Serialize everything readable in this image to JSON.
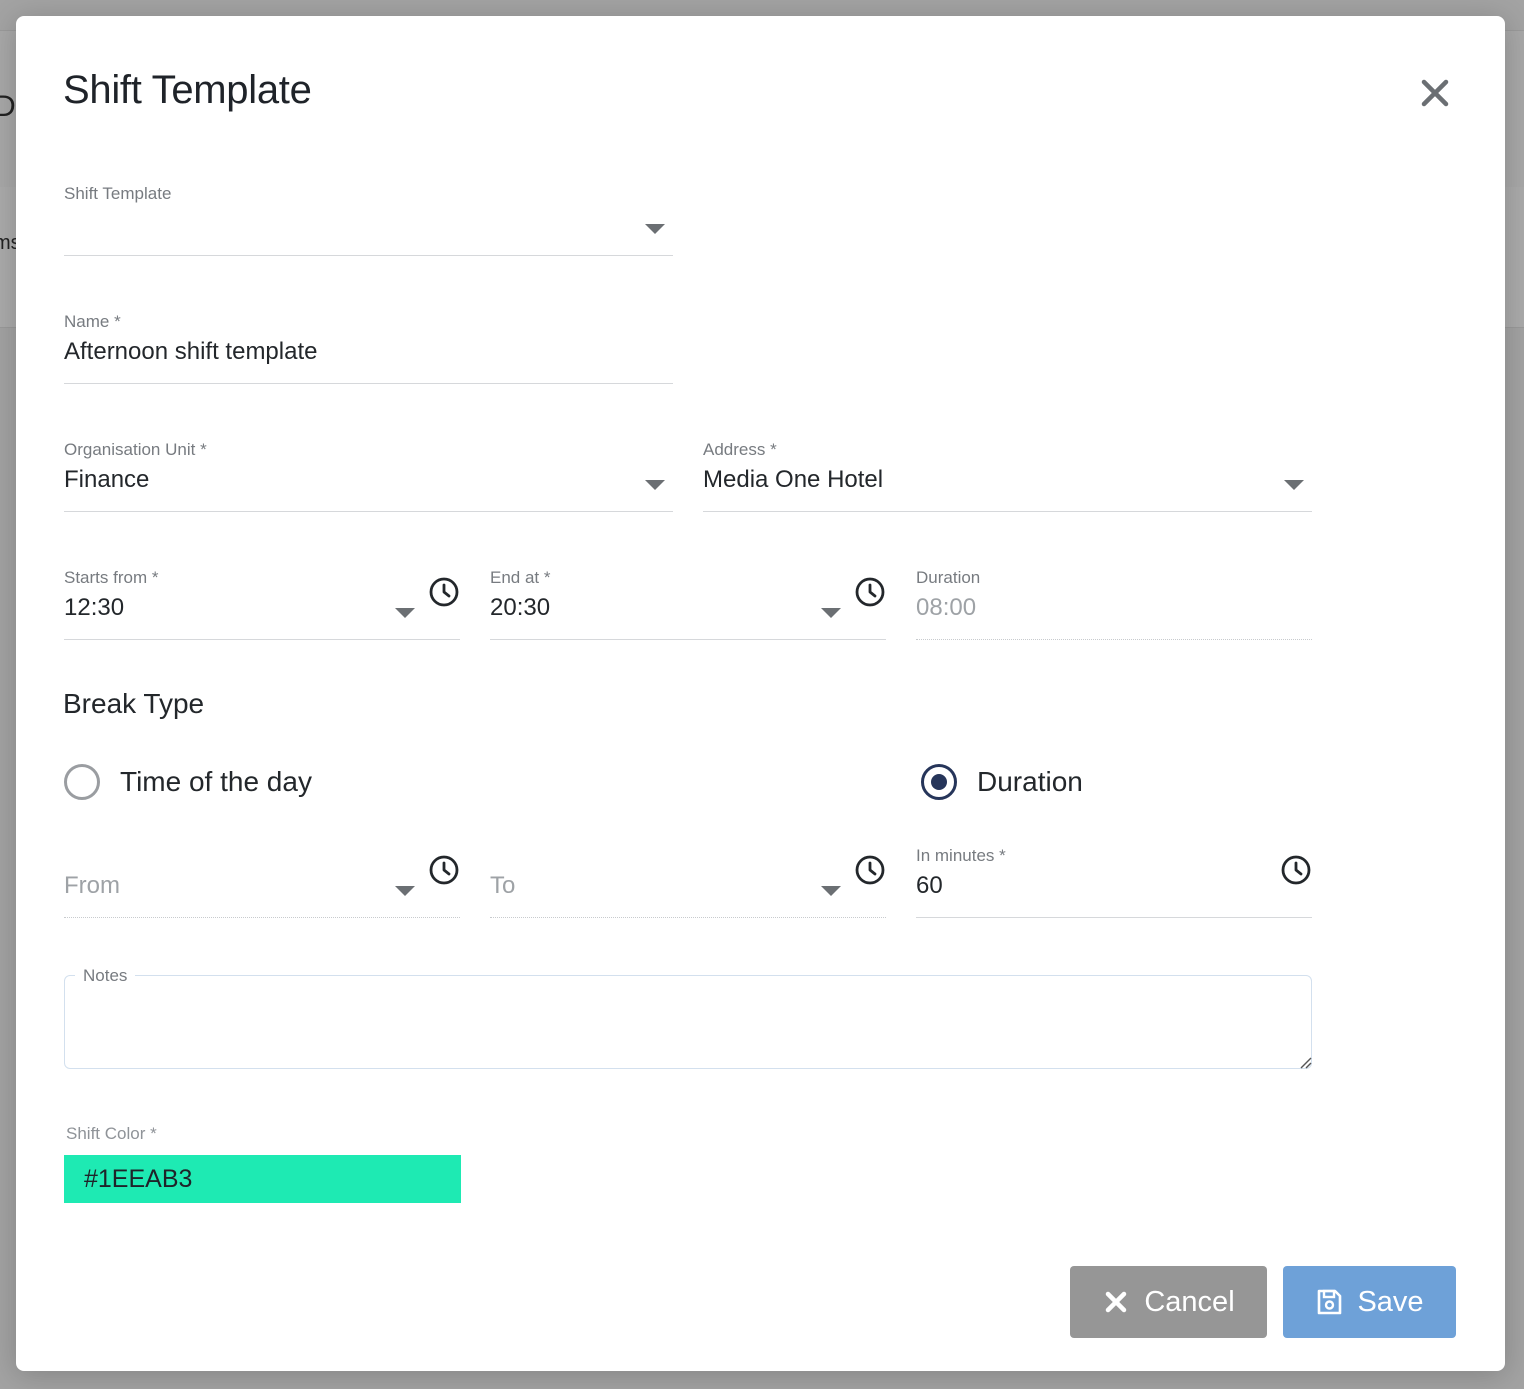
{
  "modal": {
    "title": "Shift Template"
  },
  "form": {
    "shift_template": {
      "label": "Shift Template",
      "value": ""
    },
    "name": {
      "label": "Name *",
      "value": "Afternoon shift template"
    },
    "organisation_unit": {
      "label": "Organisation Unit *",
      "value": "Finance"
    },
    "address": {
      "label": "Address *",
      "value": "Media One Hotel"
    },
    "starts_from": {
      "label": "Starts from *",
      "value": "12:30"
    },
    "end_at": {
      "label": "End at *",
      "value": "20:30"
    },
    "duration": {
      "label": "Duration",
      "value": "08:00"
    }
  },
  "break_type": {
    "title": "Break Type",
    "options": [
      {
        "label": "Time of the day",
        "selected": false
      },
      {
        "label": "Duration",
        "selected": true
      }
    ],
    "from": {
      "placeholder": "From"
    },
    "to": {
      "placeholder": "To"
    },
    "in_minutes": {
      "label": "In minutes *",
      "value": "60"
    }
  },
  "notes": {
    "label": "Notes",
    "value": ""
  },
  "shift_color": {
    "label": "Shift Color *",
    "value": "#1EEAB3",
    "color": "#1EEAB3"
  },
  "buttons": {
    "cancel": "Cancel",
    "save": "Save"
  },
  "colors": {
    "radio_selected": "#26355a",
    "save_button": "#6ea1d8",
    "cancel_button": "#969696"
  },
  "icons": {
    "close": "close-icon",
    "clock": "clock-icon",
    "dropdown": "chevron-down-icon",
    "cancel": "x-icon",
    "save": "floppy-disk-icon"
  },
  "background": {
    "partial_text_1": "Du",
    "partial_text_2": "ms"
  }
}
